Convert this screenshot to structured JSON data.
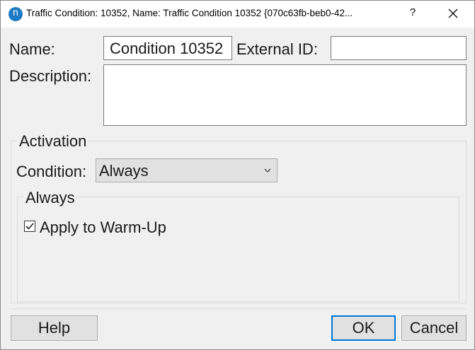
{
  "titlebar": {
    "app_icon_letter": "n",
    "title": "Traffic Condition: 10352, Name: Traffic Condition 10352  {070c63fb-beb0-42...",
    "help_label": "?",
    "icons": {
      "app": "app-n-icon",
      "close": "close-icon"
    }
  },
  "form": {
    "name_label": "Name:",
    "name_value": "Condition 10352",
    "external_id_label": "External ID:",
    "external_id_value": "",
    "description_label": "Description:",
    "description_value": ""
  },
  "activation": {
    "group_label": "Activation",
    "condition_label": "Condition:",
    "condition_value": "Always",
    "always_group_label": "Always",
    "apply_warmup_label": "Apply to Warm-Up",
    "apply_warmup_checked": true
  },
  "buttons": {
    "help": "Help",
    "ok": "OK",
    "cancel": "Cancel"
  },
  "colors": {
    "accent": "#0078d7",
    "app_icon": "#1f7ac4",
    "dialog_bg": "#f0f0f0"
  }
}
